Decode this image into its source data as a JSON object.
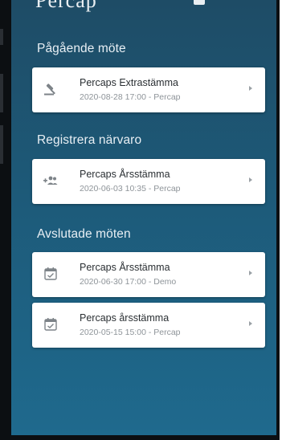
{
  "header": {
    "partial_title": "Percap"
  },
  "sections": [
    {
      "title": "Pågående möte",
      "meetings": [
        {
          "name": "Percaps Extrastämma",
          "meta": "2020-08-28 17:00 - Percap",
          "icon": "gavel-icon"
        }
      ]
    },
    {
      "title": "Registrera närvaro",
      "meetings": [
        {
          "name": "Percaps Årsstämma",
          "meta": "2020-06-03 10:35 - Percap",
          "icon": "people-add-icon"
        }
      ]
    },
    {
      "title": "Avslutade möten",
      "meetings": [
        {
          "name": "Percaps Årsstämma",
          "meta": "2020-06-30 17:00 - Demo",
          "icon": "calendar-check-icon"
        },
        {
          "name": "Percaps årsstämma",
          "meta": "2020-05-15 15:00 - Percap",
          "icon": "calendar-check-icon"
        }
      ]
    }
  ],
  "colors": {
    "background_top": "#1e4c66",
    "background_bottom": "#1f6a8e",
    "card": "#ffffff",
    "icon": "#7d8388"
  }
}
